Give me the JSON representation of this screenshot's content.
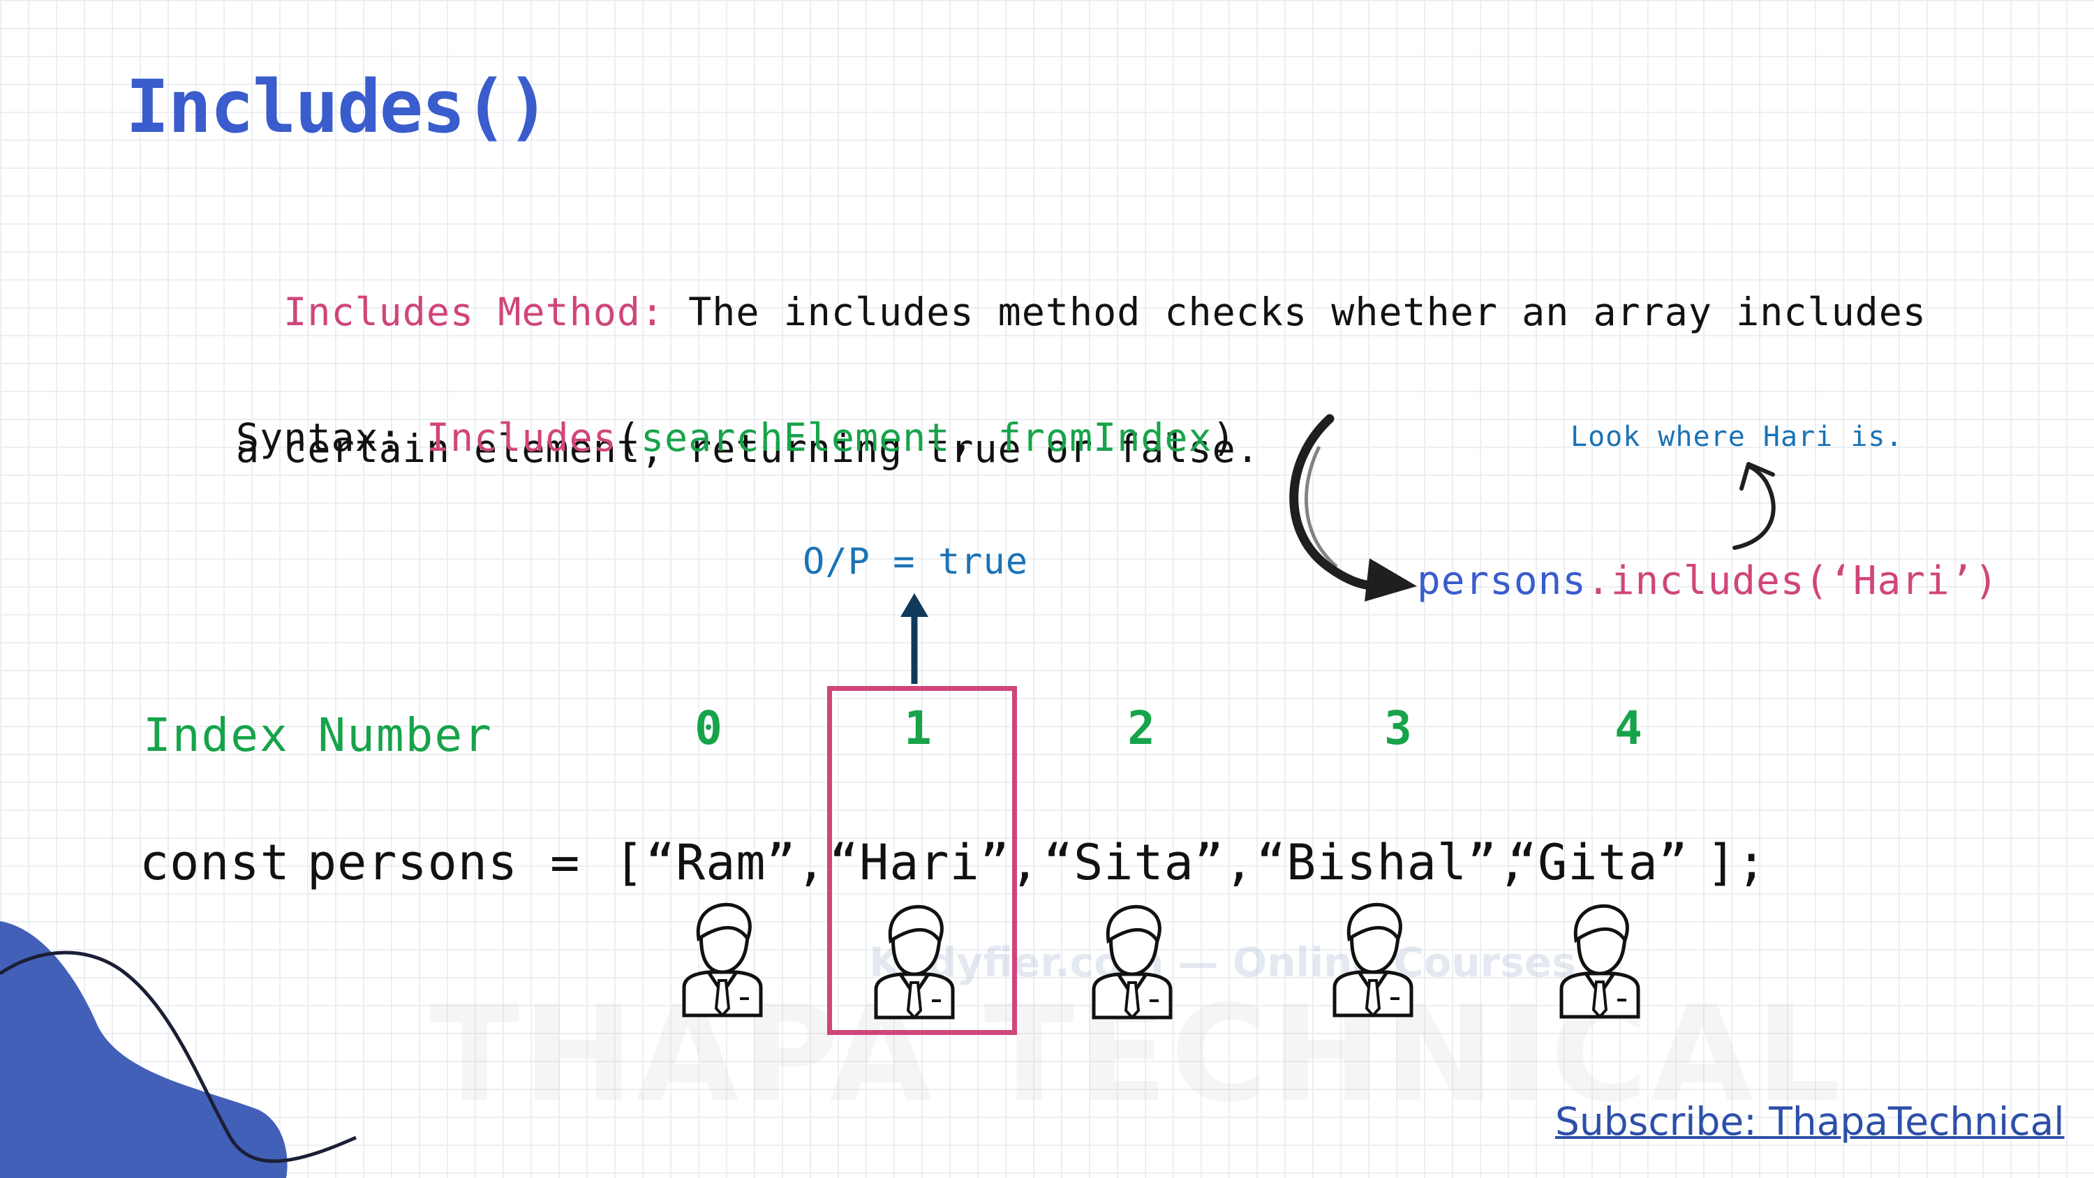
{
  "title": "Includes()",
  "description": {
    "label": "Includes Method:",
    "line1": " The includes method checks whether an array includes",
    "line2": "a certain element, returning true or false."
  },
  "syntax": {
    "prefix": "Syntax: ",
    "method": "Includes",
    "open": "(",
    "param1": "searchElement",
    "sep": ", ",
    "param2": "fromIndex",
    "close": ")"
  },
  "output": "O/P = true",
  "call": {
    "object": "persons",
    "method": ".includes(‘Hari’)"
  },
  "note": "Look where Hari is.",
  "index_label": "Index Number",
  "indices": [
    "0",
    "1",
    "2",
    "3",
    "4"
  ],
  "code": {
    "keyword": "const ",
    "var": "persons",
    "assign": " = ",
    "open": "[",
    "items": [
      "“Ram”,",
      "“Hari”,",
      "“Sita”,",
      "“Bishal”,",
      "“Gita”"
    ],
    "close": "];"
  },
  "subscribe": "Subscribe: ThapaTechnical",
  "watermarks": {
    "line1": "Kodyfier.com — Online Courses",
    "line2": "THAPA TECHNICAL"
  },
  "colors": {
    "title": "#3a5ccc",
    "label": "#d0457a",
    "green": "#17a34a",
    "output": "#1a73b5",
    "blob": "#4360b8"
  }
}
